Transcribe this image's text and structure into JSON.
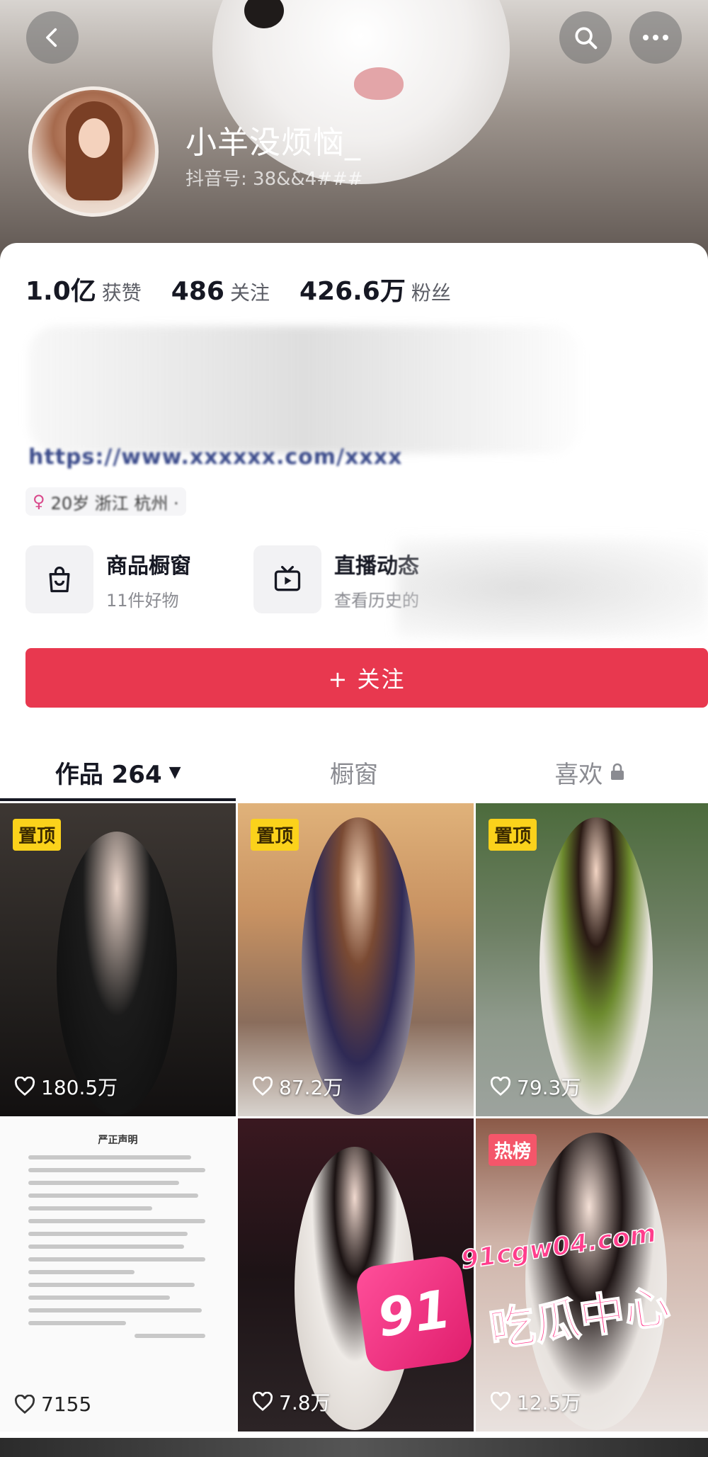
{
  "header": {
    "nickname": "小羊没烦恼_",
    "douyin_id": "抖音号: 38&&4###"
  },
  "stats": [
    {
      "num": "1.0亿",
      "label": "获赞"
    },
    {
      "num": "486",
      "label": "关注"
    },
    {
      "num": "426.6万",
      "label": "粉丝"
    }
  ],
  "bio": {
    "line": "https://www.xxxxxx.com/xxxx",
    "tag": "20岁 浙江 杭州 ·"
  },
  "services": {
    "shop_title": "商品橱窗",
    "shop_sub": "11件好物",
    "live_title": "直播动态",
    "live_sub": "查看历史的"
  },
  "follow_label": "+ 关注",
  "tabs": {
    "works": "作品 264",
    "showcase": "橱窗",
    "likes": "喜欢"
  },
  "grid": [
    {
      "badge": "置顶",
      "likes": "180.5万"
    },
    {
      "badge": "置顶",
      "likes": "87.2万"
    },
    {
      "badge": "置顶",
      "likes": "79.3万"
    },
    {
      "badge": "",
      "likes": "7155",
      "doc_title": "严正声明"
    },
    {
      "badge": "",
      "likes": "7.8万"
    },
    {
      "badge": "热榜",
      "likes": "12.5万"
    }
  ],
  "watermark": {
    "badge": "91",
    "url": "91cgw04.com",
    "text": "吃瓜中心"
  },
  "icons": [
    "back-icon",
    "search-icon",
    "more-icon",
    "shopping-bag-icon",
    "tv-play-icon",
    "heart-icon",
    "lock-icon",
    "caret-down-icon"
  ],
  "colors": {
    "accent": "#e8384f",
    "pin": "#fbd21b",
    "hot": "#f4566a"
  }
}
